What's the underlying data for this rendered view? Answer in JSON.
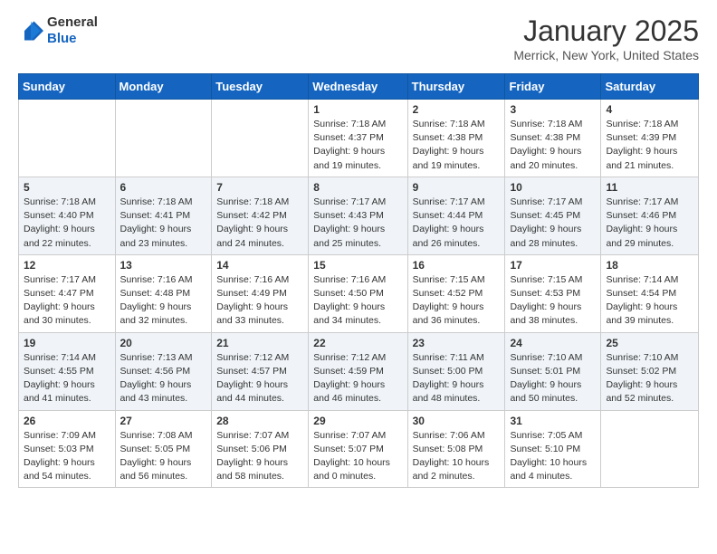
{
  "header": {
    "logo": {
      "general": "General",
      "blue": "Blue"
    },
    "title": "January 2025",
    "location": "Merrick, New York, United States"
  },
  "weekdays": [
    "Sunday",
    "Monday",
    "Tuesday",
    "Wednesday",
    "Thursday",
    "Friday",
    "Saturday"
  ],
  "weeks": [
    [
      {
        "day": "",
        "info": ""
      },
      {
        "day": "",
        "info": ""
      },
      {
        "day": "",
        "info": ""
      },
      {
        "day": "1",
        "info": "Sunrise: 7:18 AM\nSunset: 4:37 PM\nDaylight: 9 hours\nand 19 minutes."
      },
      {
        "day": "2",
        "info": "Sunrise: 7:18 AM\nSunset: 4:38 PM\nDaylight: 9 hours\nand 19 minutes."
      },
      {
        "day": "3",
        "info": "Sunrise: 7:18 AM\nSunset: 4:38 PM\nDaylight: 9 hours\nand 20 minutes."
      },
      {
        "day": "4",
        "info": "Sunrise: 7:18 AM\nSunset: 4:39 PM\nDaylight: 9 hours\nand 21 minutes."
      }
    ],
    [
      {
        "day": "5",
        "info": "Sunrise: 7:18 AM\nSunset: 4:40 PM\nDaylight: 9 hours\nand 22 minutes."
      },
      {
        "day": "6",
        "info": "Sunrise: 7:18 AM\nSunset: 4:41 PM\nDaylight: 9 hours\nand 23 minutes."
      },
      {
        "day": "7",
        "info": "Sunrise: 7:18 AM\nSunset: 4:42 PM\nDaylight: 9 hours\nand 24 minutes."
      },
      {
        "day": "8",
        "info": "Sunrise: 7:17 AM\nSunset: 4:43 PM\nDaylight: 9 hours\nand 25 minutes."
      },
      {
        "day": "9",
        "info": "Sunrise: 7:17 AM\nSunset: 4:44 PM\nDaylight: 9 hours\nand 26 minutes."
      },
      {
        "day": "10",
        "info": "Sunrise: 7:17 AM\nSunset: 4:45 PM\nDaylight: 9 hours\nand 28 minutes."
      },
      {
        "day": "11",
        "info": "Sunrise: 7:17 AM\nSunset: 4:46 PM\nDaylight: 9 hours\nand 29 minutes."
      }
    ],
    [
      {
        "day": "12",
        "info": "Sunrise: 7:17 AM\nSunset: 4:47 PM\nDaylight: 9 hours\nand 30 minutes."
      },
      {
        "day": "13",
        "info": "Sunrise: 7:16 AM\nSunset: 4:48 PM\nDaylight: 9 hours\nand 32 minutes."
      },
      {
        "day": "14",
        "info": "Sunrise: 7:16 AM\nSunset: 4:49 PM\nDaylight: 9 hours\nand 33 minutes."
      },
      {
        "day": "15",
        "info": "Sunrise: 7:16 AM\nSunset: 4:50 PM\nDaylight: 9 hours\nand 34 minutes."
      },
      {
        "day": "16",
        "info": "Sunrise: 7:15 AM\nSunset: 4:52 PM\nDaylight: 9 hours\nand 36 minutes."
      },
      {
        "day": "17",
        "info": "Sunrise: 7:15 AM\nSunset: 4:53 PM\nDaylight: 9 hours\nand 38 minutes."
      },
      {
        "day": "18",
        "info": "Sunrise: 7:14 AM\nSunset: 4:54 PM\nDaylight: 9 hours\nand 39 minutes."
      }
    ],
    [
      {
        "day": "19",
        "info": "Sunrise: 7:14 AM\nSunset: 4:55 PM\nDaylight: 9 hours\nand 41 minutes."
      },
      {
        "day": "20",
        "info": "Sunrise: 7:13 AM\nSunset: 4:56 PM\nDaylight: 9 hours\nand 43 minutes."
      },
      {
        "day": "21",
        "info": "Sunrise: 7:12 AM\nSunset: 4:57 PM\nDaylight: 9 hours\nand 44 minutes."
      },
      {
        "day": "22",
        "info": "Sunrise: 7:12 AM\nSunset: 4:59 PM\nDaylight: 9 hours\nand 46 minutes."
      },
      {
        "day": "23",
        "info": "Sunrise: 7:11 AM\nSunset: 5:00 PM\nDaylight: 9 hours\nand 48 minutes."
      },
      {
        "day": "24",
        "info": "Sunrise: 7:10 AM\nSunset: 5:01 PM\nDaylight: 9 hours\nand 50 minutes."
      },
      {
        "day": "25",
        "info": "Sunrise: 7:10 AM\nSunset: 5:02 PM\nDaylight: 9 hours\nand 52 minutes."
      }
    ],
    [
      {
        "day": "26",
        "info": "Sunrise: 7:09 AM\nSunset: 5:03 PM\nDaylight: 9 hours\nand 54 minutes."
      },
      {
        "day": "27",
        "info": "Sunrise: 7:08 AM\nSunset: 5:05 PM\nDaylight: 9 hours\nand 56 minutes."
      },
      {
        "day": "28",
        "info": "Sunrise: 7:07 AM\nSunset: 5:06 PM\nDaylight: 9 hours\nand 58 minutes."
      },
      {
        "day": "29",
        "info": "Sunrise: 7:07 AM\nSunset: 5:07 PM\nDaylight: 10 hours\nand 0 minutes."
      },
      {
        "day": "30",
        "info": "Sunrise: 7:06 AM\nSunset: 5:08 PM\nDaylight: 10 hours\nand 2 minutes."
      },
      {
        "day": "31",
        "info": "Sunrise: 7:05 AM\nSunset: 5:10 PM\nDaylight: 10 hours\nand 4 minutes."
      },
      {
        "day": "",
        "info": ""
      }
    ]
  ]
}
